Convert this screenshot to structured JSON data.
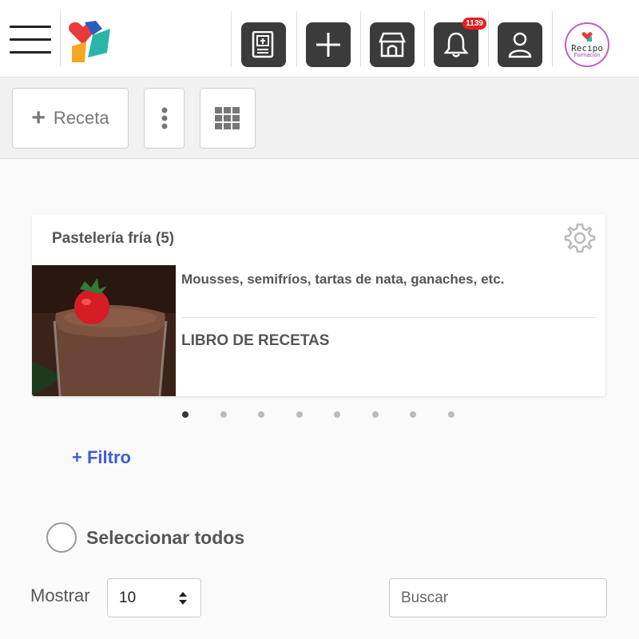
{
  "navbar": {
    "notification_count": "1139",
    "avatar": {
      "brand": "Recipo",
      "sub": "Formación"
    }
  },
  "toolbar": {
    "add_recipe_label": "Receta"
  },
  "category_card": {
    "title": "Pastelería fría (5)",
    "description": "Mousses, semifríos, tartas de nata, ganaches, etc.",
    "link_label": "LIBRO DE RECETAS",
    "carousel": {
      "total": 8,
      "active_index": 0
    }
  },
  "filter": {
    "label": "+ Filtro"
  },
  "select_all": {
    "label": "Seleccionar todos"
  },
  "pagination": {
    "show_label": "Mostrar",
    "page_size": "10"
  },
  "search": {
    "placeholder": "Buscar"
  },
  "colors": {
    "icon_button_bg": "#3b3b3b",
    "badge": "#e02020",
    "filter_link": "#3d5ed6"
  }
}
